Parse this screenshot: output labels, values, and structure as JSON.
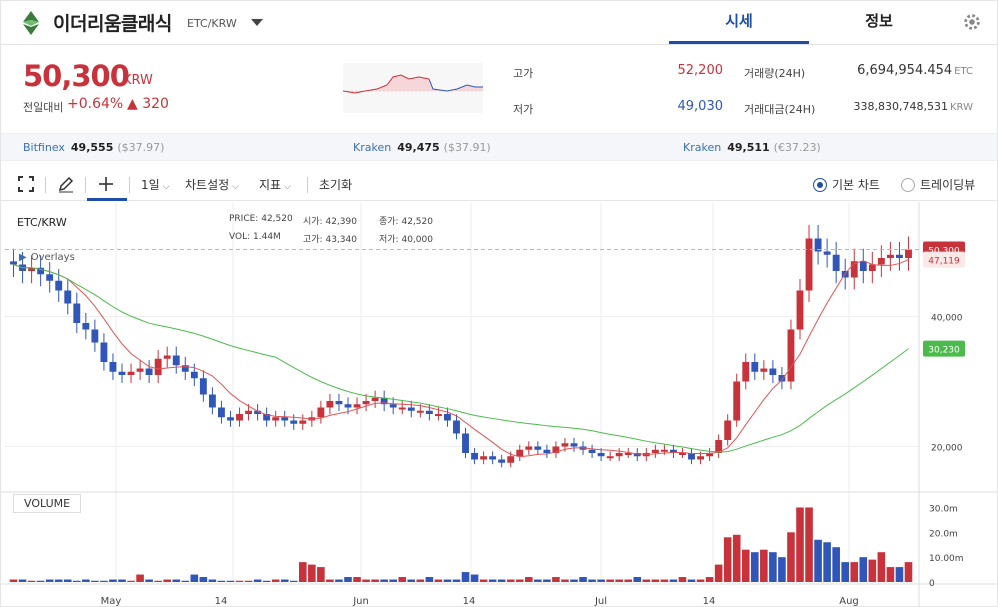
{
  "header": {
    "coin_name": "이더리움클래식",
    "pair": "ETC/KRW",
    "tabs": [
      {
        "label": "시세",
        "active": true
      },
      {
        "label": "정보",
        "active": false
      }
    ],
    "settings_icon": "gear-icon"
  },
  "summary": {
    "price": "50,300",
    "unit": "KRW",
    "change_label": "전일대비",
    "change_pct": "+0.64%",
    "change_abs": "▲ 320",
    "high_label": "고가",
    "high_value": "52,200",
    "low_label": "저가",
    "low_value": "49,030",
    "volume_label": "거래량(24H)",
    "volume_value": "6,694,954.454",
    "volume_unit": "ETC",
    "amount_label": "거래대금(24H)",
    "amount_value": "338,830,748,531",
    "amount_unit": "KRW"
  },
  "exchanges": [
    {
      "name": "Bitfinex",
      "price": "49,555",
      "sub": "($37.97)"
    },
    {
      "name": "Kraken",
      "price": "49,475",
      "sub": "($37.91)"
    },
    {
      "name": "Kraken",
      "price": "49,511",
      "sub": "(€37.23)"
    }
  ],
  "toolbar": {
    "interval": "1일",
    "settings": "차트설정",
    "indicators": "지표",
    "reset": "초기화",
    "view_basic": "기본 차트",
    "view_trading": "트레이딩뷰"
  },
  "colors": {
    "up": "#c8323a",
    "down": "#2f56b8",
    "ma_short": "#e05555",
    "ma_long": "#4cbb4c",
    "accent": "#1e4ea8"
  },
  "chart_data": {
    "type": "candlestick",
    "pair_label": "ETC/KRW",
    "overlays_label": "Overlays",
    "ohlc": {
      "price_label": "PRICE:",
      "price": "42,520",
      "open_label": "시가:",
      "open": "42,390",
      "close_label": "종가:",
      "close": "42,520",
      "vol_label": "VOL:",
      "vol": "1.44M",
      "high_label": "고가:",
      "high": "43,340",
      "low_label": "저가:",
      "low": "40,000"
    },
    "y_ticks": [
      "40,000",
      "20,000"
    ],
    "y_ticks_values": [
      40000,
      20000
    ],
    "current_price_tag": "50,300",
    "ma_tags": [
      "47,119",
      "30,230"
    ],
    "x_labels": [
      "May",
      "14",
      "Jun",
      "14",
      "Jul",
      "14",
      "Aug"
    ],
    "volume_label": "VOLUME",
    "volume_ticks": [
      "30.0m",
      "20.0m",
      "10.00m",
      "0"
    ],
    "candles_up_down_note": "",
    "closes": [
      48000,
      47000,
      47500,
      46500,
      45500,
      44000,
      42000,
      39000,
      38000,
      36000,
      33000,
      31500,
      31000,
      31500,
      32000,
      31000,
      33500,
      34000,
      32500,
      31500,
      30500,
      28000,
      26000,
      24500,
      24000,
      25000,
      25500,
      25000,
      24000,
      24500,
      24000,
      23500,
      24000,
      24500,
      26000,
      27000,
      26500,
      26000,
      26500,
      27000,
      27500,
      26500,
      26000,
      26000,
      25500,
      25500,
      25000,
      25000,
      24000,
      22000,
      19000,
      18000,
      18500,
      18000,
      17500,
      18500,
      19500,
      20000,
      19500,
      19000,
      20000,
      20500,
      20000,
      19500,
      19000,
      18500,
      18500,
      19000,
      19000,
      18500,
      19000,
      19500,
      19500,
      19000,
      19000,
      18000,
      18500,
      19000,
      21000,
      24000,
      30000,
      33000,
      31500,
      32000,
      31000,
      30000,
      38000,
      44000,
      52000,
      50000,
      49500,
      47000,
      46000,
      48500,
      47000,
      48000,
      49000,
      49500,
      49000,
      50300
    ],
    "volumes_m": [
      1,
      1,
      0.5,
      0.5,
      1,
      1,
      1,
      0.5,
      1,
      0.5,
      0.5,
      1,
      1,
      0.5,
      3,
      1,
      0.5,
      1,
      1,
      0.5,
      3,
      2,
      1,
      0.5,
      0.5,
      0.5,
      0.5,
      1,
      0.5,
      1,
      1,
      0.5,
      8,
      7,
      6,
      1,
      1,
      2,
      2,
      1,
      1,
      1,
      1,
      2,
      1,
      1,
      2,
      1,
      1,
      1,
      4,
      3,
      1,
      1,
      1,
      1,
      1,
      2,
      1,
      1,
      2,
      1,
      1,
      2,
      1,
      1,
      1,
      1,
      1,
      2,
      1,
      1,
      1,
      1,
      2,
      1,
      1,
      2,
      7,
      18,
      19,
      13,
      12,
      13,
      12,
      10,
      20,
      30,
      30,
      17,
      16,
      14,
      8,
      8,
      10,
      9,
      12,
      6,
      6,
      8
    ]
  }
}
